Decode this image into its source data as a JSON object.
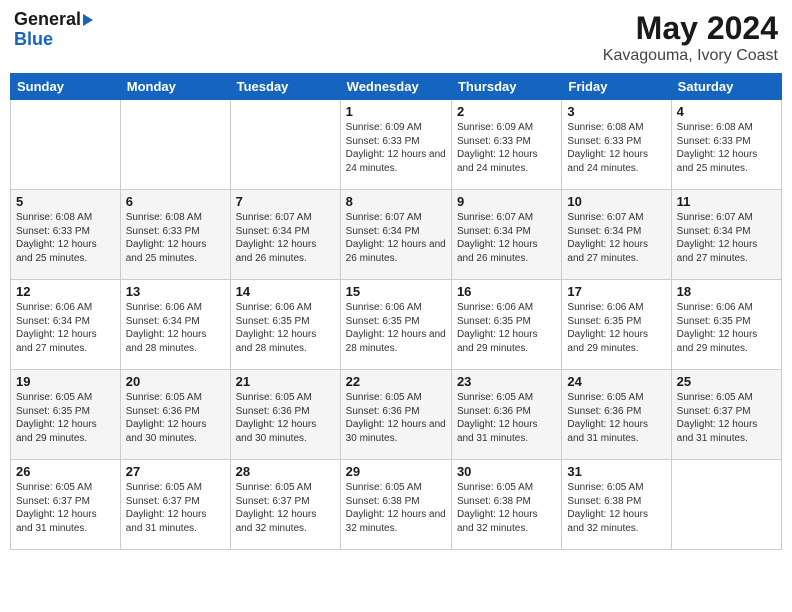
{
  "logo": {
    "general": "General",
    "blue": "Blue",
    "arrow": "▶"
  },
  "title": {
    "month_year": "May 2024",
    "location": "Kavagouma, Ivory Coast"
  },
  "weekdays": [
    "Sunday",
    "Monday",
    "Tuesday",
    "Wednesday",
    "Thursday",
    "Friday",
    "Saturday"
  ],
  "weeks": [
    [
      {
        "day": "",
        "info": ""
      },
      {
        "day": "",
        "info": ""
      },
      {
        "day": "",
        "info": ""
      },
      {
        "day": "1",
        "info": "Sunrise: 6:09 AM\nSunset: 6:33 PM\nDaylight: 12 hours\nand 24 minutes."
      },
      {
        "day": "2",
        "info": "Sunrise: 6:09 AM\nSunset: 6:33 PM\nDaylight: 12 hours\nand 24 minutes."
      },
      {
        "day": "3",
        "info": "Sunrise: 6:08 AM\nSunset: 6:33 PM\nDaylight: 12 hours\nand 24 minutes."
      },
      {
        "day": "4",
        "info": "Sunrise: 6:08 AM\nSunset: 6:33 PM\nDaylight: 12 hours\nand 25 minutes."
      }
    ],
    [
      {
        "day": "5",
        "info": "Sunrise: 6:08 AM\nSunset: 6:33 PM\nDaylight: 12 hours\nand 25 minutes."
      },
      {
        "day": "6",
        "info": "Sunrise: 6:08 AM\nSunset: 6:33 PM\nDaylight: 12 hours\nand 25 minutes."
      },
      {
        "day": "7",
        "info": "Sunrise: 6:07 AM\nSunset: 6:34 PM\nDaylight: 12 hours\nand 26 minutes."
      },
      {
        "day": "8",
        "info": "Sunrise: 6:07 AM\nSunset: 6:34 PM\nDaylight: 12 hours\nand 26 minutes."
      },
      {
        "day": "9",
        "info": "Sunrise: 6:07 AM\nSunset: 6:34 PM\nDaylight: 12 hours\nand 26 minutes."
      },
      {
        "day": "10",
        "info": "Sunrise: 6:07 AM\nSunset: 6:34 PM\nDaylight: 12 hours\nand 27 minutes."
      },
      {
        "day": "11",
        "info": "Sunrise: 6:07 AM\nSunset: 6:34 PM\nDaylight: 12 hours\nand 27 minutes."
      }
    ],
    [
      {
        "day": "12",
        "info": "Sunrise: 6:06 AM\nSunset: 6:34 PM\nDaylight: 12 hours\nand 27 minutes."
      },
      {
        "day": "13",
        "info": "Sunrise: 6:06 AM\nSunset: 6:34 PM\nDaylight: 12 hours\nand 28 minutes."
      },
      {
        "day": "14",
        "info": "Sunrise: 6:06 AM\nSunset: 6:35 PM\nDaylight: 12 hours\nand 28 minutes."
      },
      {
        "day": "15",
        "info": "Sunrise: 6:06 AM\nSunset: 6:35 PM\nDaylight: 12 hours\nand 28 minutes."
      },
      {
        "day": "16",
        "info": "Sunrise: 6:06 AM\nSunset: 6:35 PM\nDaylight: 12 hours\nand 29 minutes."
      },
      {
        "day": "17",
        "info": "Sunrise: 6:06 AM\nSunset: 6:35 PM\nDaylight: 12 hours\nand 29 minutes."
      },
      {
        "day": "18",
        "info": "Sunrise: 6:06 AM\nSunset: 6:35 PM\nDaylight: 12 hours\nand 29 minutes."
      }
    ],
    [
      {
        "day": "19",
        "info": "Sunrise: 6:05 AM\nSunset: 6:35 PM\nDaylight: 12 hours\nand 29 minutes."
      },
      {
        "day": "20",
        "info": "Sunrise: 6:05 AM\nSunset: 6:36 PM\nDaylight: 12 hours\nand 30 minutes."
      },
      {
        "day": "21",
        "info": "Sunrise: 6:05 AM\nSunset: 6:36 PM\nDaylight: 12 hours\nand 30 minutes."
      },
      {
        "day": "22",
        "info": "Sunrise: 6:05 AM\nSunset: 6:36 PM\nDaylight: 12 hours\nand 30 minutes."
      },
      {
        "day": "23",
        "info": "Sunrise: 6:05 AM\nSunset: 6:36 PM\nDaylight: 12 hours\nand 31 minutes."
      },
      {
        "day": "24",
        "info": "Sunrise: 6:05 AM\nSunset: 6:36 PM\nDaylight: 12 hours\nand 31 minutes."
      },
      {
        "day": "25",
        "info": "Sunrise: 6:05 AM\nSunset: 6:37 PM\nDaylight: 12 hours\nand 31 minutes."
      }
    ],
    [
      {
        "day": "26",
        "info": "Sunrise: 6:05 AM\nSunset: 6:37 PM\nDaylight: 12 hours\nand 31 minutes."
      },
      {
        "day": "27",
        "info": "Sunrise: 6:05 AM\nSunset: 6:37 PM\nDaylight: 12 hours\nand 31 minutes."
      },
      {
        "day": "28",
        "info": "Sunrise: 6:05 AM\nSunset: 6:37 PM\nDaylight: 12 hours\nand 32 minutes."
      },
      {
        "day": "29",
        "info": "Sunrise: 6:05 AM\nSunset: 6:38 PM\nDaylight: 12 hours\nand 32 minutes."
      },
      {
        "day": "30",
        "info": "Sunrise: 6:05 AM\nSunset: 6:38 PM\nDaylight: 12 hours\nand 32 minutes."
      },
      {
        "day": "31",
        "info": "Sunrise: 6:05 AM\nSunset: 6:38 PM\nDaylight: 12 hours\nand 32 minutes."
      },
      {
        "day": "",
        "info": ""
      }
    ]
  ]
}
